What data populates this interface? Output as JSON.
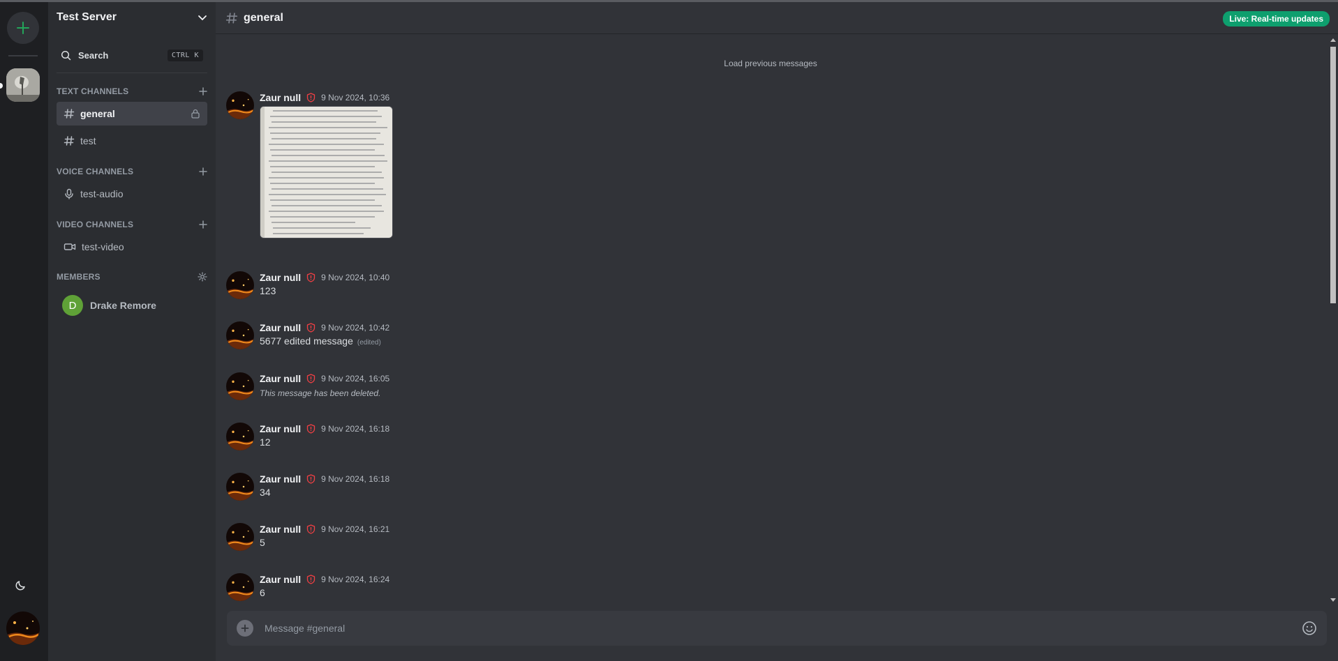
{
  "colors": {
    "accent_green": "#23a55a",
    "live_badge": "#0e9f6e",
    "member_avatar": "#5fa137",
    "shield_red": "#f23f43"
  },
  "rail": {
    "add_server_icon": "plus-icon",
    "theme_icon": "moon-icon"
  },
  "server": {
    "name": "Test Server"
  },
  "search": {
    "label": "Search",
    "shortcut": "CTRL K"
  },
  "categories": {
    "text": "TEXT CHANNELS",
    "voice": "VOICE CHANNELS",
    "video": "VIDEO CHANNELS",
    "members": "MEMBERS"
  },
  "channels": {
    "text": [
      {
        "name": "general",
        "active": true,
        "locked": true
      },
      {
        "name": "test"
      }
    ],
    "voice": [
      {
        "name": "test-audio"
      }
    ],
    "video": [
      {
        "name": "test-video"
      }
    ]
  },
  "members": [
    {
      "initial": "D",
      "name": "Drake Remore"
    }
  ],
  "header": {
    "channel": "general",
    "live_badge": "Live: Real-time updates"
  },
  "load_previous": "Load previous messages",
  "messages": [
    {
      "author": "Zaur null",
      "time": "9 Nov 2024, 10:36",
      "type": "image"
    },
    {
      "author": "Zaur null",
      "time": "9 Nov 2024, 10:40",
      "text": "123"
    },
    {
      "author": "Zaur null",
      "time": "9 Nov 2024, 10:42",
      "text": "5677 edited message",
      "edited": "(edited)"
    },
    {
      "author": "Zaur null",
      "time": "9 Nov 2024, 16:05",
      "deleted": "This message has been deleted."
    },
    {
      "author": "Zaur null",
      "time": "9 Nov 2024, 16:18",
      "text": "12"
    },
    {
      "author": "Zaur null",
      "time": "9 Nov 2024, 16:18",
      "text": "34"
    },
    {
      "author": "Zaur null",
      "time": "9 Nov 2024, 16:21",
      "text": "5"
    },
    {
      "author": "Zaur null",
      "time": "9 Nov 2024, 16:24",
      "text": "6"
    }
  ],
  "composer": {
    "placeholder": "Message #general"
  }
}
